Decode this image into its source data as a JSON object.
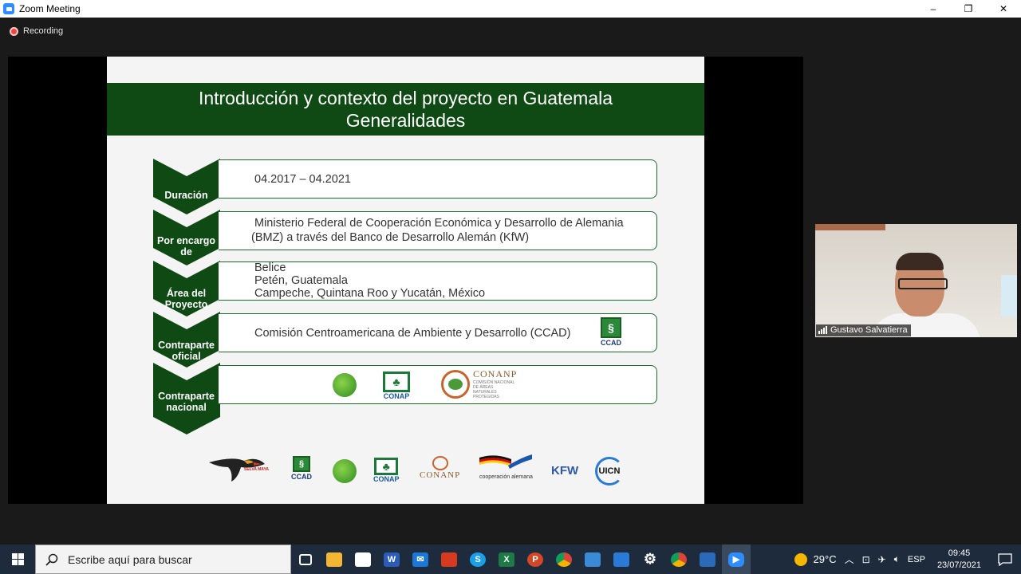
{
  "window": {
    "title": "Zoom Meeting",
    "minimize": "–",
    "restore": "❐",
    "close": "✕"
  },
  "recording": {
    "label": "Recording"
  },
  "slide": {
    "title_line1": "Introducción y contexto del proyecto en Guatemala",
    "title_line2": "Generalidades",
    "rows": [
      {
        "label_l1": "Duración",
        "label_l2": "",
        "text": [
          "04.2017 – 04.2021"
        ]
      },
      {
        "label_l1": "Por encargo",
        "label_l2": "de",
        "text": [
          "Ministerio Federal de Cooperación Económica y Desarrollo de Alemania",
          "(BMZ) a través del Banco de Desarrollo Alemán (KfW)"
        ]
      },
      {
        "label_l1": "Área del",
        "label_l2": "Proyecto",
        "text": [
          "Belice",
          "Petén, Guatemala",
          "Campeche, Quintana Roo y Yucatán, México"
        ]
      },
      {
        "label_l1": "Contraparte",
        "label_l2": "oficial",
        "text": [
          "Comisión Centroamericana de Ambiente y Desarrollo (CCAD)"
        ]
      },
      {
        "label_l1": "Contraparte",
        "label_l2": "nacional",
        "text": []
      }
    ],
    "logo_labels": {
      "ccad": "CCAD",
      "conap": "CONAP",
      "conanp": "CONANP",
      "conanp_sub": "COMISIÓN NACIONAL DE ÁREAS NATURALES PROTEGIDAS",
      "selva_maya": "SELVA MAYA",
      "cooperacion": "cooperación alemana",
      "kfw": "KFW",
      "uicn": "UICN"
    },
    "colors": {
      "header_bg": "#0f4a14",
      "chevron": "#0f4a14",
      "box_border": "#1d6a2a"
    }
  },
  "participant": {
    "name": "Gustavo Salvatierra"
  },
  "taskbar": {
    "search_placeholder": "Escribe aquí para buscar",
    "weather": "29°C",
    "language": "ESP",
    "time": "09:45",
    "date": "23/07/2021",
    "apps": [
      "task-view",
      "file-explorer",
      "store",
      "word",
      "mail",
      "office",
      "skype",
      "excel",
      "powerpoint",
      "chrome",
      "camtasia",
      "calendar",
      "settings",
      "chrome-alt",
      "photos",
      "zoom"
    ]
  }
}
